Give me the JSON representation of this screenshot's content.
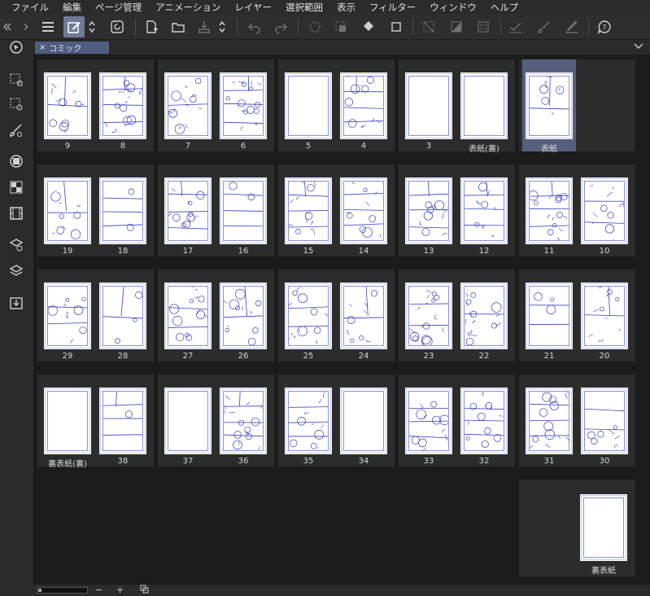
{
  "menu": [
    "ファイル",
    "編集",
    "ページ管理",
    "アニメーション",
    "レイヤー",
    "選択範囲",
    "表示",
    "フィルター",
    "ウィンドウ",
    "ヘルプ"
  ],
  "tab": {
    "label": "コミック",
    "close": "×"
  },
  "rows": [
    {
      "spreads": [
        [
          "9",
          "8"
        ],
        [
          "7",
          "6"
        ],
        [
          "5",
          "4"
        ],
        [
          "3",
          "表紙(裏)"
        ],
        [
          "表紙"
        ]
      ]
    },
    {
      "spreads": [
        [
          "19",
          "18"
        ],
        [
          "17",
          "16"
        ],
        [
          "15",
          "14"
        ],
        [
          "13",
          "12"
        ],
        [
          "11",
          "10"
        ]
      ]
    },
    {
      "spreads": [
        [
          "29",
          "28"
        ],
        [
          "27",
          "26"
        ],
        [
          "25",
          "24"
        ],
        [
          "23",
          "22"
        ],
        [
          "21",
          "20"
        ]
      ]
    },
    {
      "spreads": [
        [
          "裏表紙(裏)",
          "38"
        ],
        [
          "37",
          "36"
        ],
        [
          "35",
          "34"
        ],
        [
          "33",
          "32"
        ],
        [
          "31",
          "30"
        ]
      ]
    },
    {
      "spreads": [
        [
          "裏表紙"
        ]
      ]
    }
  ],
  "selected_page": "表紙",
  "status": {
    "minus": "−",
    "plus": "+"
  },
  "colors": {
    "accent": "#6f7a99",
    "selection": "#56607e",
    "sketch": "#3a3fc0",
    "frame": "#8c90d8"
  }
}
